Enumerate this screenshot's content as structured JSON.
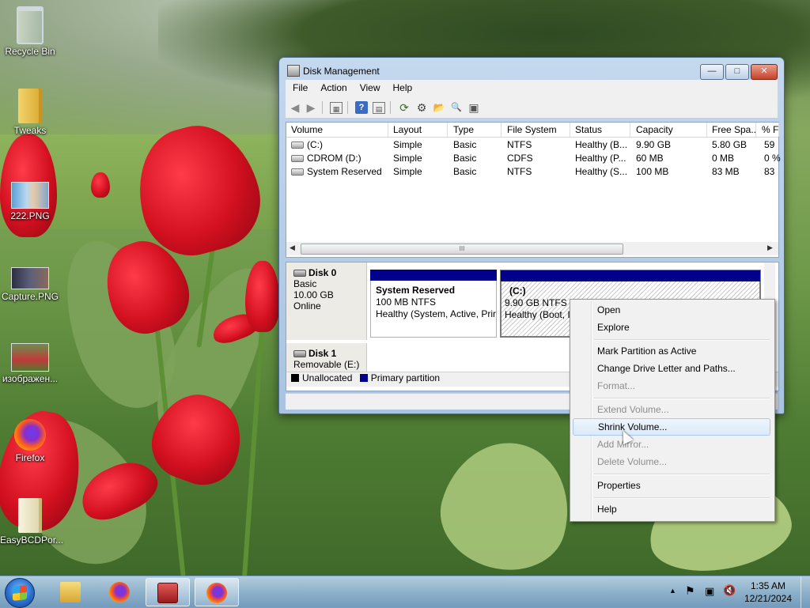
{
  "desktop": {
    "icons": [
      {
        "label": "Recycle Bin"
      },
      {
        "label": "Tweaks"
      },
      {
        "label": "222.PNG"
      },
      {
        "label": "Capture.PNG"
      },
      {
        "label": "изображен..."
      },
      {
        "label": "Firefox"
      },
      {
        "label": "EasyBCDPor..."
      }
    ]
  },
  "window": {
    "title": "Disk Management",
    "controls": {
      "minimize": "—",
      "maximize": "□",
      "close": "✕"
    },
    "menu": [
      "File",
      "Action",
      "View",
      "Help"
    ],
    "toolbar_icons": [
      "back-icon",
      "forward-icon",
      "console-tree-icon",
      "help-icon",
      "properties-list-icon",
      "refresh-icon",
      "rescan-icon",
      "open-icon",
      "search-icon",
      "settings-icon"
    ],
    "toolbar_glyphs": {
      "back": "◀",
      "forward": "▶",
      "tree": "▦",
      "help": "?",
      "list": "▤",
      "refresh": "⟳",
      "rescan": "⚙",
      "open": "📂",
      "search": "🔍",
      "settings": "▣"
    }
  },
  "volume_list": {
    "columns": [
      "Volume",
      "Layout",
      "Type",
      "File System",
      "Status",
      "Capacity",
      "Free Spa...",
      "% F"
    ],
    "rows": [
      [
        "(C:)",
        "Simple",
        "Basic",
        "NTFS",
        "Healthy (B...",
        "9.90 GB",
        "5.80 GB",
        "59"
      ],
      [
        "CDROM (D:)",
        "Simple",
        "Basic",
        "CDFS",
        "Healthy (P...",
        "60 MB",
        "0 MB",
        "0 %"
      ],
      [
        "System Reserved",
        "Simple",
        "Basic",
        "NTFS",
        "Healthy (S...",
        "100 MB",
        "83 MB",
        "83"
      ]
    ],
    "scroll_grip": "III",
    "scroll_left": "◀",
    "scroll_right": "▶"
  },
  "disk_map": {
    "disk0": {
      "name": "Disk 0",
      "type": "Basic",
      "size": "10.00 GB",
      "status": "Online"
    },
    "partitions": [
      {
        "title": "System Reserved",
        "size_fs": "100 MB NTFS",
        "status": "Healthy (System, Active, Prir"
      },
      {
        "title": "(C:)",
        "size_fs": "9.90 GB NTFS",
        "status": "Healthy (Boot, I"
      }
    ],
    "disk1": {
      "name": "Disk 1",
      "type": "Removable (E:)"
    },
    "legend": [
      {
        "label": "Unallocated",
        "color": "#000000"
      },
      {
        "label": "Primary partition",
        "color": "#00008b"
      }
    ]
  },
  "context_menu": {
    "items": [
      {
        "label": "Open",
        "enabled": true
      },
      {
        "label": "Explore",
        "enabled": true
      },
      {
        "label": "Mark Partition as Active",
        "enabled": true
      },
      {
        "label": "Change Drive Letter and Paths...",
        "enabled": true
      },
      {
        "label": "Format...",
        "enabled": false
      },
      {
        "label": "Extend Volume...",
        "enabled": false
      },
      {
        "label": "Shrink Volume...",
        "enabled": true,
        "highlighted": true
      },
      {
        "label": "Add Mirror...",
        "enabled": false
      },
      {
        "label": "Delete Volume...",
        "enabled": false
      },
      {
        "label": "Properties",
        "enabled": true
      },
      {
        "label": "Help",
        "enabled": true
      }
    ]
  },
  "taskbar": {
    "tray_glyphs": {
      "chevron": "▲",
      "flag": "⚑",
      "network": "▣",
      "volume": "🔇"
    },
    "time": "1:35 AM",
    "date": "12/21/2024"
  },
  "colors": {
    "primary_partition": "#00008b",
    "highlight": "#dbe9f9",
    "disabled_text": "#8d8d8d"
  }
}
